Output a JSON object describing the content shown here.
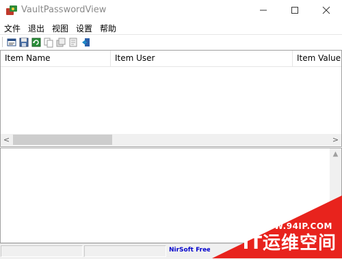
{
  "window": {
    "title": "VaultPasswordView",
    "minimize_label": "—",
    "maximize_label": "☐",
    "close_label": "✕"
  },
  "menu": {
    "items": [
      "文件",
      "退出",
      "视图",
      "设置",
      "帮助"
    ]
  },
  "toolbar": {
    "icons": [
      "properties-icon",
      "save-icon",
      "refresh-icon",
      "copy-icon",
      "copy-all-icon",
      "html-report-icon",
      "exit-icon"
    ]
  },
  "list": {
    "columns": [
      "Item Name",
      "Item User",
      "Item Value"
    ],
    "rows": []
  },
  "scroll": {
    "left_arrow": "<",
    "right_arrow": ">",
    "up_arrow": "▲",
    "down_arrow": "▼"
  },
  "status": {
    "link_text": "NirSoft Freeware"
  },
  "watermark": {
    "url": "WWW.94IP.COM",
    "brand": "IT运维空间"
  },
  "colors": {
    "watermark_red": "#e8231d",
    "status_link": "#0000cc"
  }
}
